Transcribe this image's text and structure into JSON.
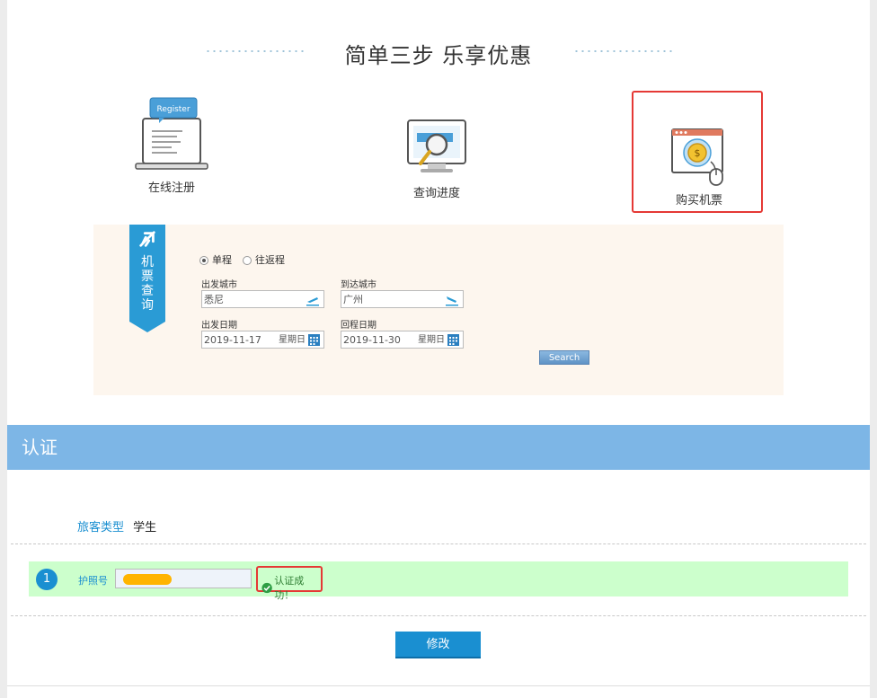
{
  "steps": {
    "title": "简单三步 乐享优惠",
    "items": [
      {
        "label": "在线注册",
        "icon": "laptop-register-icon",
        "badge": "Register"
      },
      {
        "label": "查询进度",
        "icon": "monitor-search-icon"
      },
      {
        "label": "购买机票",
        "icon": "browser-payment-icon"
      }
    ]
  },
  "search": {
    "ribbon_chars": [
      "机",
      "票",
      "查",
      "询"
    ],
    "trip_types": [
      "单程",
      "往返程"
    ],
    "depart_city_label": "出发城市",
    "depart_city_value": "悉尼",
    "arrive_city_label": "到达城市",
    "arrive_city_value": "广州",
    "depart_date_label": "出发日期",
    "depart_date_value": "2019-11-17",
    "depart_weekday": "星期日",
    "return_date_label": "回程日期",
    "return_date_value": "2019-11-30",
    "return_weekday": "星期日",
    "search_button": "Search"
  },
  "auth": {
    "title": "认证",
    "passenger_type_label": "旅客类型",
    "passenger_type_value": "学生",
    "row_number": "1",
    "passport_label": "护照号",
    "success_text": "认证成功！",
    "modify_button": "修改"
  },
  "colors": {
    "accent_blue": "#1a8fd1",
    "header_blue": "#7db6e6",
    "success_green_bg": "#ccffcc",
    "highlight_red": "#e53935",
    "search_panel_bg": "#fdf6ee"
  }
}
